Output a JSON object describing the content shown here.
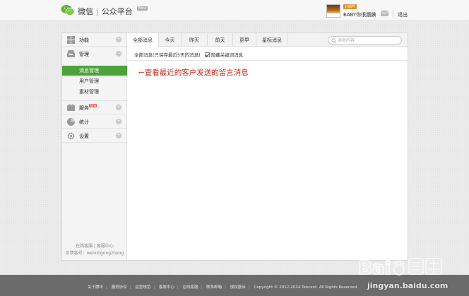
{
  "header": {
    "brand_name": "微信",
    "brand_separator": "|",
    "platform_name": "公众平台",
    "beta_badge": "Beta",
    "account_badge": "订阅号",
    "user_name": "BABY你很腼腆",
    "logout_label": "退出"
  },
  "sidebar": {
    "sections": [
      {
        "label": "功能",
        "icon": "grid-icon"
      },
      {
        "label": "管理",
        "icon": "inbox-icon"
      },
      {
        "label": "服务",
        "icon": "service-icon",
        "badge": "NEW"
      },
      {
        "label": "统计",
        "icon": "pie-chart-icon"
      },
      {
        "label": "设置",
        "icon": "gear-icon"
      }
    ],
    "sub_items": [
      "消息管理",
      "用户管理",
      "素材管理"
    ],
    "footer_line1": "在线客服 | 客服中心",
    "footer_line2": "反馈客号：weixingongzhong"
  },
  "tabs": [
    "全部消息",
    "今天",
    "昨天",
    "前天",
    "更早",
    "星标消息"
  ],
  "active_tab": "全部消息",
  "search": {
    "placeholder": "消息内容"
  },
  "filter": {
    "info_text": "全部消息(只保存最近5天的消息)",
    "hide_keyword_label": "隐藏关键词消息",
    "hide_keyword_checked": true
  },
  "annotation": "←查看最近的客户发送的留言消息",
  "footer": {
    "links": [
      "关于腾讯",
      "服务协议",
      "运营规范",
      "客服中心",
      "在线客服",
      "联系邮箱",
      "侵权投诉"
    ],
    "copyright": "Copyright © 2012-2014 Tencent. All Rights Reserved."
  },
  "watermark": {
    "url": "jingyan.baidu.com"
  },
  "colors": {
    "accent_green": "#4ba339",
    "annotation_red": "#c0281e",
    "footer_bg": "#6b6b6b"
  }
}
